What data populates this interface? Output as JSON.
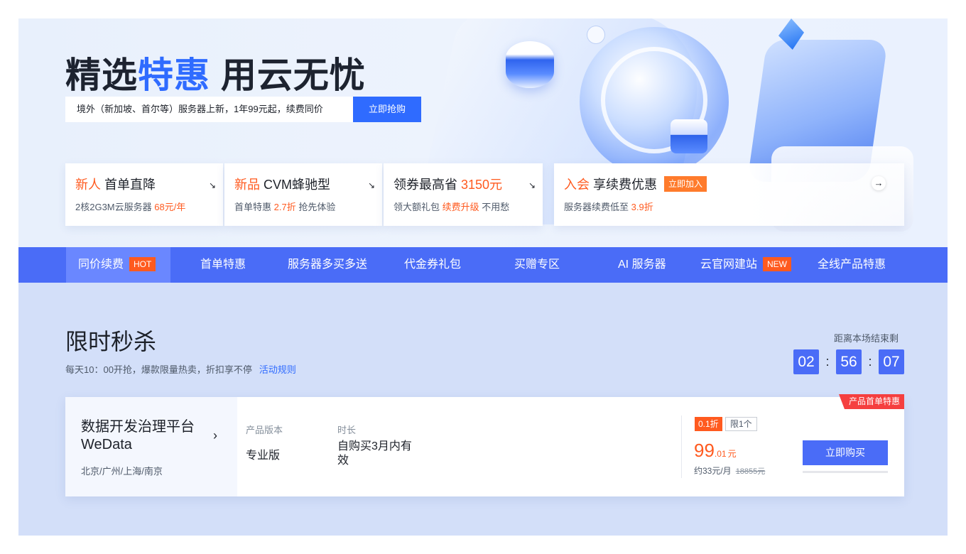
{
  "hero": {
    "headline_part1": "精选",
    "headline_part2": "特惠",
    "headline_part3": " 用云无忧",
    "subtitle": "境外（新加坡、首尔等）服务器上新，1年99元起，续费同价",
    "cta_label": "立即抢购"
  },
  "promo_cards": [
    {
      "title_accent": "新人",
      "title_rest": " 首单直降",
      "sub_text": "2核2G3M云服务器 ",
      "sub_accent": "68元/年",
      "sub_after": ""
    },
    {
      "title_accent": "新品",
      "title_rest": " CVM蜂驰型",
      "sub_text": "首单特惠 ",
      "sub_accent": "2.7折",
      "sub_after": " 抢先体验"
    },
    {
      "title_accent": "",
      "title_rest": "领券最高省 ",
      "title_accent2": "3150元",
      "sub_text": "领大额礼包 ",
      "sub_accent": "续费升级",
      "sub_after": " 不用愁"
    },
    {
      "title_accent": "入会",
      "title_rest": " 享续费优惠",
      "tag": "立即加入",
      "sub_text": "服务器续费低至 ",
      "sub_accent": "3.9折",
      "sub_after": ""
    }
  ],
  "nav": {
    "items": [
      {
        "label": "同价续费",
        "badge": "HOT"
      },
      {
        "label": "首单特惠"
      },
      {
        "label": "服务器多买多送"
      },
      {
        "label": "代金券礼包"
      },
      {
        "label": "买赠专区"
      },
      {
        "label": "AI 服务器"
      },
      {
        "label": "云官网建站",
        "badge": "NEW"
      },
      {
        "label": "全线产品特惠"
      }
    ]
  },
  "flash": {
    "title": "限时秒杀",
    "subtitle": "每天10：00开抢，爆款限量热卖，折扣享不停",
    "rules_link": "活动规则",
    "countdown_label": "距离本场结束剩",
    "hours": "02",
    "minutes": "56",
    "seconds": "07",
    "separator": ":"
  },
  "product": {
    "name": "数据开发治理平台 WeData",
    "regions": "北京/广州/上海/南京",
    "version_label": "产品版本",
    "version_value": "专业版",
    "duration_label": "时长",
    "duration_value": "自购买3月内有效",
    "discount_tag": "0.1折",
    "limit_tag": "限1个",
    "price_int": "99",
    "price_dec": ".01",
    "price_unit": "元",
    "per_month": "约33元/月",
    "original_price": "18855元",
    "buy_label": "立即购买",
    "corner_badge": "产品首单特惠"
  },
  "colors": {
    "primary": "#4a6cf7",
    "accent_blue": "#2f6bff",
    "orange": "#ff5a1f",
    "red": "#f53f3f"
  }
}
